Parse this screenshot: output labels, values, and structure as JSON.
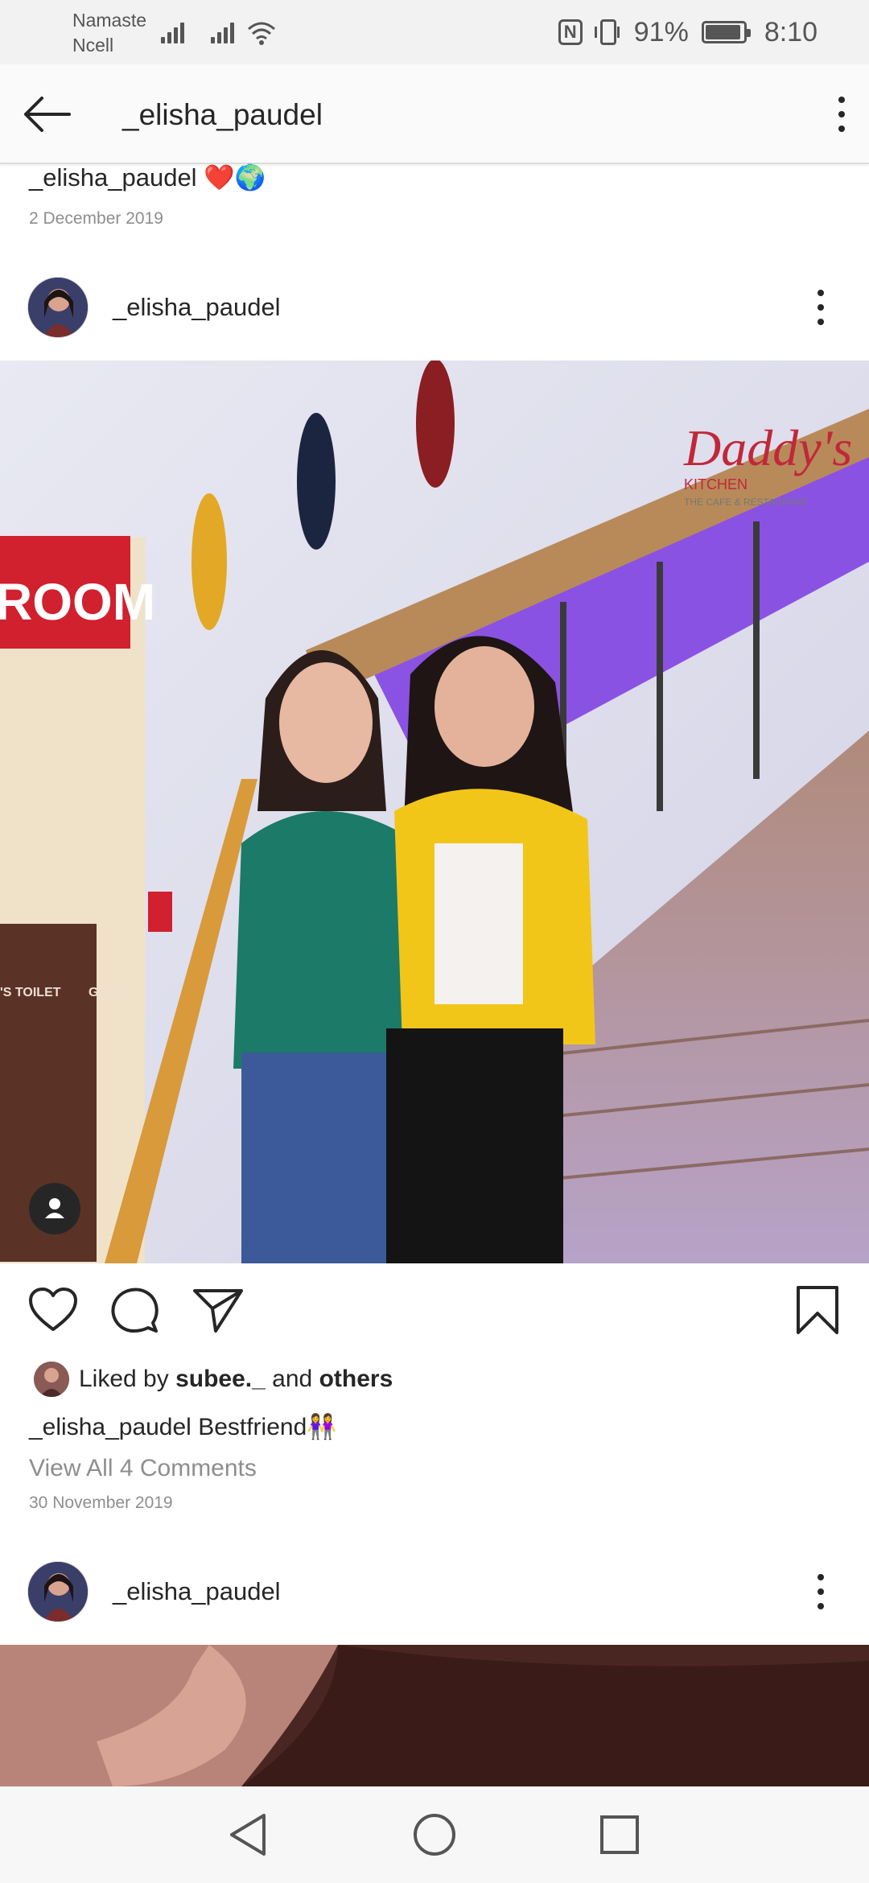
{
  "status_bar": {
    "carrier_line1": "Namaste",
    "carrier_line2": "Ncell",
    "battery_text": "91%",
    "battery_level": 0.91,
    "time": "8:10"
  },
  "header": {
    "title": "_elisha_paudel"
  },
  "previous_post": {
    "caption_user": "_elisha_paudel",
    "caption_emoji": "❤️🌍",
    "date": "2 December 2019"
  },
  "post": {
    "username": "_elisha_paudel",
    "liked_by_prefix": "Liked by",
    "liked_by_user": "subee._",
    "liked_by_and": "and",
    "liked_by_others": "others",
    "caption_user": "_elisha_paudel",
    "caption_text": "Bestfriend👭",
    "view_comments": "View All 4 Comments",
    "date": "30 November 2019",
    "photo_text": {
      "sign_room": "ROOM",
      "logo_name": "Daddy's",
      "logo_sub": "KITCHEN",
      "logo_tagline": "THE CAFE & RESTAURANT",
      "toilet_sign": "'S TOILET",
      "gents_sign": "GENTS"
    }
  },
  "next_post": {
    "username": "_elisha_paudel"
  },
  "icons": {
    "back": "arrow-left-icon",
    "more": "more-vertical-icon",
    "like": "heart-icon",
    "comment": "comment-bubble-icon",
    "share": "send-paper-plane-icon",
    "save": "bookmark-icon",
    "user_tag": "person-icon",
    "nav_back": "triangle-back-icon",
    "nav_home": "circle-home-icon",
    "nav_recents": "square-recents-icon"
  },
  "colors": {
    "text": "#262626",
    "muted": "#8e8e8e",
    "neon_purple": "#8a2be2",
    "logo_red": "#c0283a"
  }
}
